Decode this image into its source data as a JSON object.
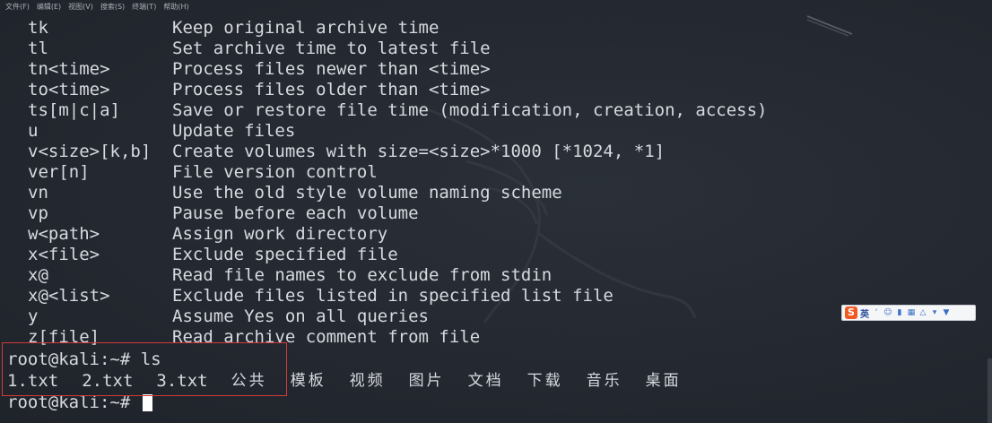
{
  "menubar": {
    "items": [
      "文件(F)",
      "编辑(E)",
      "视图(V)",
      "搜索(S)",
      "终端(T)",
      "帮助(H)"
    ]
  },
  "options": [
    {
      "flag": "tk",
      "desc": "Keep original archive time"
    },
    {
      "flag": "tl",
      "desc": "Set archive time to latest file"
    },
    {
      "flag": "tn<time>",
      "desc": "Process files newer than <time>"
    },
    {
      "flag": "to<time>",
      "desc": "Process files older than <time>"
    },
    {
      "flag": "ts[m|c|a]",
      "desc": "Save or restore file time (modification, creation, access)"
    },
    {
      "flag": "u",
      "desc": "Update files"
    },
    {
      "flag": "v<size>[k,b]",
      "desc": "Create volumes with size=<size>*1000 [*1024, *1]"
    },
    {
      "flag": "ver[n]",
      "desc": "File version control"
    },
    {
      "flag": "vn",
      "desc": "Use the old style volume naming scheme"
    },
    {
      "flag": "vp",
      "desc": "Pause before each volume"
    },
    {
      "flag": "w<path>",
      "desc": "Assign work directory"
    },
    {
      "flag": "x<file>",
      "desc": "Exclude specified file"
    },
    {
      "flag": "x@",
      "desc": "Read file names to exclude from stdin"
    },
    {
      "flag": "x@<list>",
      "desc": "Exclude files listed in specified list file"
    },
    {
      "flag": "y",
      "desc": "Assume Yes on all queries"
    },
    {
      "flag": "z[file]",
      "desc": "Read archive comment from file"
    }
  ],
  "shell": {
    "prompt": "root@kali:~# ",
    "command": "ls",
    "ls_output": [
      "1.txt",
      "2.txt",
      "3.txt",
      "公共",
      "模板",
      "视频",
      "图片",
      "文档",
      "下载",
      "音乐",
      "桌面"
    ]
  },
  "ime_toolbar": {
    "logo": "S",
    "lang": "英",
    "buttons": [
      "punctuation-icon",
      "emoji-icon",
      "microphone-icon",
      "keyboard-icon",
      "skin-icon",
      "tools-icon",
      "shirt-icon"
    ]
  },
  "colors": {
    "terminal_bg": "#23272e",
    "text": "#d7dadf",
    "highlight_border": "#d43a3a",
    "ime_accent": "#f05a22"
  }
}
